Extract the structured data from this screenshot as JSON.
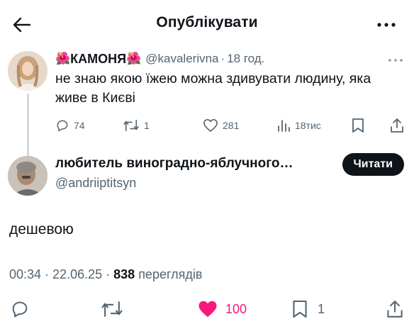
{
  "header": {
    "title": "Опублікувати"
  },
  "parent_post": {
    "display_name": "КАМОНЯ",
    "name_emoji": "🌺",
    "handle": "@kavalerivna",
    "time": "18 год.",
    "text": "не знаю якою їжею можна здивувати людину, яка живе в Києві",
    "replies": "74",
    "reposts": "1",
    "likes": "281",
    "views": "18тис"
  },
  "reply_post": {
    "display_name": "любитель виноградно-яблучного…",
    "handle": "@andriiptitsyn",
    "read_button": "Читати",
    "text": "дешевою",
    "time": "00:34",
    "date": "22.06.25",
    "views_count": "838",
    "views_label": "переглядів",
    "likes": "100",
    "bookmarks": "1",
    "liked": true,
    "like_color": "#f91880"
  },
  "icons": [
    "arrow-left-icon",
    "more-icon",
    "reply-icon",
    "repost-icon",
    "heart-icon",
    "views-icon",
    "bookmark-icon",
    "share-icon"
  ]
}
